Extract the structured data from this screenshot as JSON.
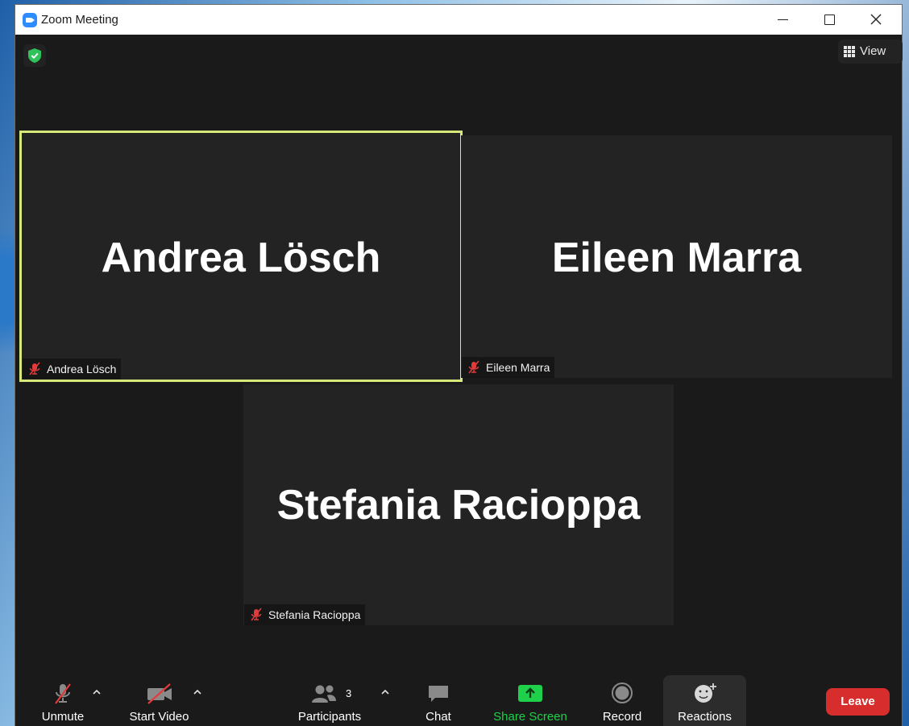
{
  "window": {
    "title": "Zoom Meeting"
  },
  "meeting": {
    "view_label": "View",
    "tiles": [
      {
        "display_name": "Andrea Lösch",
        "label": "Andrea Lösch",
        "muted": true,
        "active_speaker": true
      },
      {
        "display_name": "Eileen Marra",
        "label": "Eileen Marra",
        "muted": true,
        "active_speaker": false
      },
      {
        "display_name": "Stefania Racioppa",
        "label": "Stefania Racioppa",
        "muted": true,
        "active_speaker": false
      }
    ]
  },
  "toolbar": {
    "unmute_label": "Unmute",
    "start_video_label": "Start Video",
    "participants_label": "Participants",
    "participants_count": "3",
    "chat_label": "Chat",
    "share_screen_label": "Share Screen",
    "record_label": "Record",
    "reactions_label": "Reactions",
    "leave_label": "Leave"
  },
  "colors": {
    "accent_green": "#1fd04a",
    "leave_red": "#d72d2d",
    "active_speaker": "#d7e97a",
    "security_green": "#2fc25b"
  },
  "icons": {
    "app": "zoom-app-icon",
    "security": "shield-check-icon",
    "view": "grid-icon",
    "muted": "mic-muted-icon",
    "video_off": "video-off-icon",
    "participants": "people-icon",
    "chat": "chat-bubble-icon",
    "share": "share-screen-icon",
    "record": "record-icon",
    "reactions": "reactions-icon"
  }
}
